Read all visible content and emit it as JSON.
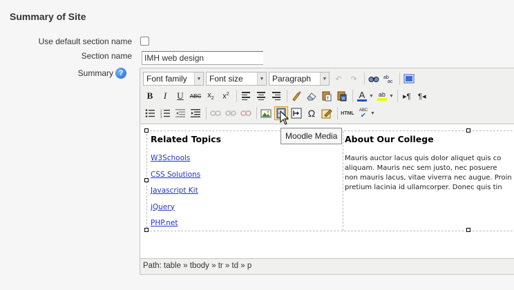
{
  "page": {
    "title": "Summary of Site"
  },
  "form": {
    "default_section_label": "Use default section name",
    "default_section_checked": false,
    "section_name_label": "Section name",
    "section_name_value": "IMH web design",
    "summary_label": "Summary",
    "help_icon_glyph": "?"
  },
  "toolbar": {
    "font_family": "Font family",
    "font_size": "Font size",
    "format": "Paragraph",
    "bold_glyph": "B",
    "italic_glyph": "I",
    "underline_glyph": "U",
    "strike_glyph": "ABC",
    "subscript_glyph": "x",
    "superscript_glyph": "x",
    "ltr_glyph": "¶",
    "rtl_glyph": "¶",
    "html_glyph": "HTML",
    "omega_glyph": "Ω",
    "abc_glyph": "ABC",
    "ab_glyph": "ab",
    "a_glyph": "A",
    "tooltip": "Moodle Media"
  },
  "content": {
    "left_heading": "Related Topics",
    "links": [
      "W3Schools",
      "CSS Solutions",
      "Javascript Kit",
      "jQuery",
      "PHP.net"
    ],
    "right_heading": "About Our College",
    "paragraph_lines": [
      "Mauris auctor lacus quis dolor aliquet quis co",
      "aliquam. Mauris nec sem justo, nec posuere",
      "non mauris lacus, vitae viverra nec augue. Proin",
      "pretium lacinia id ullamcorper. Donec quis tin"
    ]
  },
  "statusbar": {
    "path_text": "Path: table » tbody » tr » td » p"
  },
  "colors": {
    "link": "#2233cc",
    "tooltip_bg": "#f6f6f6",
    "hover_button": "#ffe7a1"
  },
  "icons": [
    "help-icon",
    "undo-icon",
    "redo-icon",
    "find-icon",
    "replace-icon",
    "fullscreen-icon",
    "cleanup-icon",
    "eraser-icon",
    "paste-text-icon",
    "paste-word-icon",
    "font-color-icon",
    "highlight-icon",
    "bullet-list-icon",
    "numbered-list-icon",
    "outdent-icon",
    "indent-icon",
    "link-icon",
    "unlink-icon",
    "anchor-icon",
    "image-icon",
    "moodle-media-icon",
    "nonbreaking-icon",
    "special-char-icon",
    "moodle-nolink-icon",
    "spellcheck-icon",
    "mouse-cursor-icon"
  ]
}
